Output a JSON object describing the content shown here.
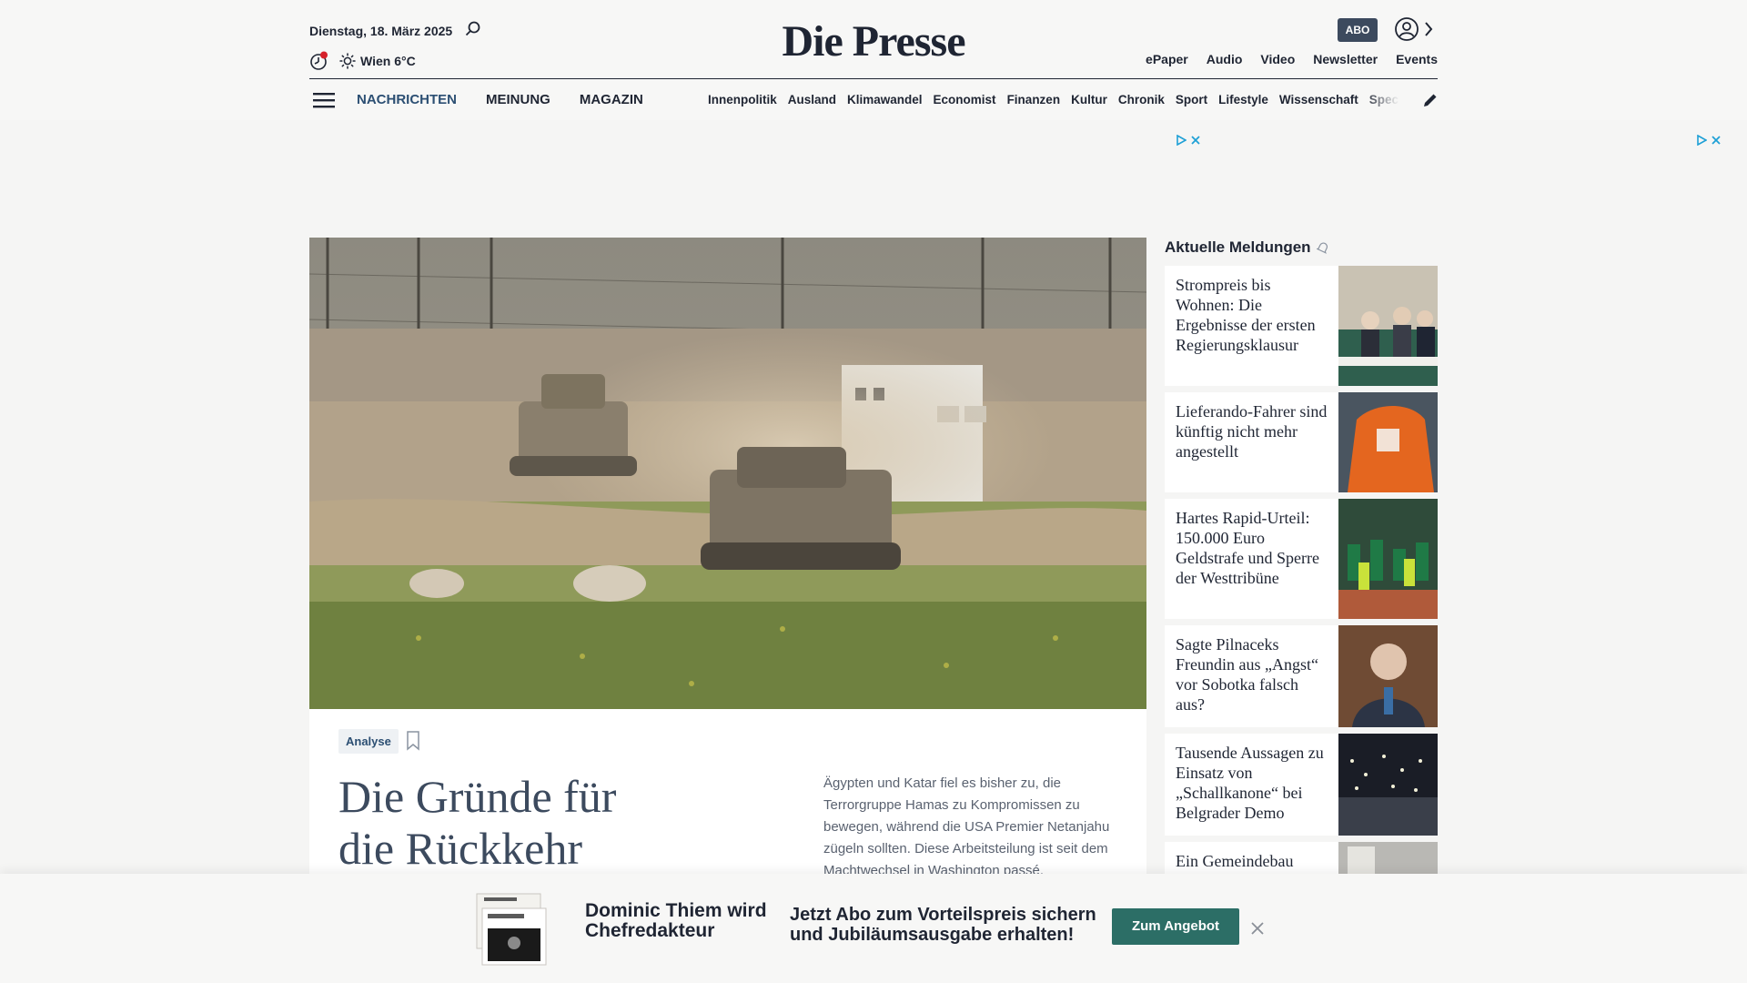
{
  "header": {
    "date": "Dienstag, 18. März 2025",
    "weather": "Wien 6°C",
    "logo": "Die Presse",
    "abo_label": "ABO",
    "top_links": [
      "ePaper",
      "Audio",
      "Video",
      "Newsletter",
      "Events"
    ],
    "nav_main": [
      "NACHRICHTEN",
      "MEINUNG",
      "MAGAZIN"
    ],
    "nav_sub": [
      "Innenpolitik",
      "Ausland",
      "Klimawandel",
      "Economist",
      "Finanzen",
      "Kultur",
      "Chronik",
      "Sport",
      "Lifestyle",
      "Wissenschaft",
      "Spectrum"
    ],
    "colors": {
      "accent": "#2c4f73",
      "text": "#1f2533",
      "abo_bg": "#3c4a5e"
    }
  },
  "hero_article": {
    "tag": "Analyse",
    "headline": "Die Gründe für die Rückkehr",
    "teaser": "Ägypten und Katar fiel es bisher zu, die Terrorgruppe Hamas zu Kompromissen zu bewegen, während die USA Premier Netanjahu zügeln sollten. Diese Arbeitsteilung ist seit dem Machtwechsel in Washington passé."
  },
  "sidebar": {
    "title": "Aktuelle Meldungen",
    "items": [
      {
        "title": "Strompreis bis Wohnen: Die Ergebnisse der ersten Regierungsklausur"
      },
      {
        "title": "Lieferando-Fahrer sind künftig nicht mehr angestellt"
      },
      {
        "title": "Hartes Rapid-Urteil: 150.000 Euro Geldstrafe und Sperre der Westtribüne"
      },
      {
        "title": "Sagte Pilnaceks Freundin aus „Angst“ vor Sobotka falsch aus?"
      },
      {
        "title": "Tausende Aussagen zu Einsatz von „Schallkanone“ bei Belgrader Demo"
      },
      {
        "title": "Ein Gemeindebau"
      }
    ]
  },
  "promo": {
    "name": "Dominic Thiem wird Chefredakteur",
    "offer": "Jetzt Abo zum Vorteilspreis sichern und Jubiläumsausgabe erhalten!",
    "button": "Zum Angebot",
    "button_color": "#2c6e66"
  }
}
